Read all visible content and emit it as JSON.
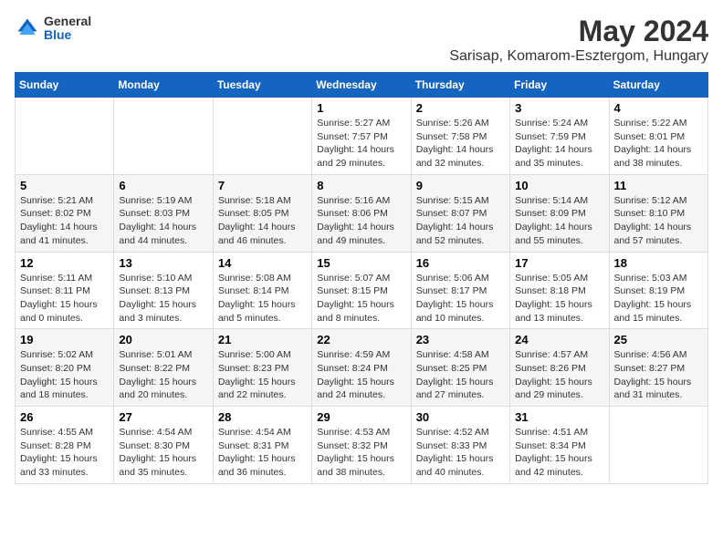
{
  "logo": {
    "line1": "General",
    "line2": "Blue"
  },
  "title": "May 2024",
  "subtitle": "Sarisap, Komarom-Esztergom, Hungary",
  "days_of_week": [
    "Sunday",
    "Monday",
    "Tuesday",
    "Wednesday",
    "Thursday",
    "Friday",
    "Saturday"
  ],
  "weeks": [
    [
      {
        "day": "",
        "content": ""
      },
      {
        "day": "",
        "content": ""
      },
      {
        "day": "",
        "content": ""
      },
      {
        "day": "1",
        "content": "Sunrise: 5:27 AM\nSunset: 7:57 PM\nDaylight: 14 hours\nand 29 minutes."
      },
      {
        "day": "2",
        "content": "Sunrise: 5:26 AM\nSunset: 7:58 PM\nDaylight: 14 hours\nand 32 minutes."
      },
      {
        "day": "3",
        "content": "Sunrise: 5:24 AM\nSunset: 7:59 PM\nDaylight: 14 hours\nand 35 minutes."
      },
      {
        "day": "4",
        "content": "Sunrise: 5:22 AM\nSunset: 8:01 PM\nDaylight: 14 hours\nand 38 minutes."
      }
    ],
    [
      {
        "day": "5",
        "content": "Sunrise: 5:21 AM\nSunset: 8:02 PM\nDaylight: 14 hours\nand 41 minutes."
      },
      {
        "day": "6",
        "content": "Sunrise: 5:19 AM\nSunset: 8:03 PM\nDaylight: 14 hours\nand 44 minutes."
      },
      {
        "day": "7",
        "content": "Sunrise: 5:18 AM\nSunset: 8:05 PM\nDaylight: 14 hours\nand 46 minutes."
      },
      {
        "day": "8",
        "content": "Sunrise: 5:16 AM\nSunset: 8:06 PM\nDaylight: 14 hours\nand 49 minutes."
      },
      {
        "day": "9",
        "content": "Sunrise: 5:15 AM\nSunset: 8:07 PM\nDaylight: 14 hours\nand 52 minutes."
      },
      {
        "day": "10",
        "content": "Sunrise: 5:14 AM\nSunset: 8:09 PM\nDaylight: 14 hours\nand 55 minutes."
      },
      {
        "day": "11",
        "content": "Sunrise: 5:12 AM\nSunset: 8:10 PM\nDaylight: 14 hours\nand 57 minutes."
      }
    ],
    [
      {
        "day": "12",
        "content": "Sunrise: 5:11 AM\nSunset: 8:11 PM\nDaylight: 15 hours\nand 0 minutes."
      },
      {
        "day": "13",
        "content": "Sunrise: 5:10 AM\nSunset: 8:13 PM\nDaylight: 15 hours\nand 3 minutes."
      },
      {
        "day": "14",
        "content": "Sunrise: 5:08 AM\nSunset: 8:14 PM\nDaylight: 15 hours\nand 5 minutes."
      },
      {
        "day": "15",
        "content": "Sunrise: 5:07 AM\nSunset: 8:15 PM\nDaylight: 15 hours\nand 8 minutes."
      },
      {
        "day": "16",
        "content": "Sunrise: 5:06 AM\nSunset: 8:17 PM\nDaylight: 15 hours\nand 10 minutes."
      },
      {
        "day": "17",
        "content": "Sunrise: 5:05 AM\nSunset: 8:18 PM\nDaylight: 15 hours\nand 13 minutes."
      },
      {
        "day": "18",
        "content": "Sunrise: 5:03 AM\nSunset: 8:19 PM\nDaylight: 15 hours\nand 15 minutes."
      }
    ],
    [
      {
        "day": "19",
        "content": "Sunrise: 5:02 AM\nSunset: 8:20 PM\nDaylight: 15 hours\nand 18 minutes."
      },
      {
        "day": "20",
        "content": "Sunrise: 5:01 AM\nSunset: 8:22 PM\nDaylight: 15 hours\nand 20 minutes."
      },
      {
        "day": "21",
        "content": "Sunrise: 5:00 AM\nSunset: 8:23 PM\nDaylight: 15 hours\nand 22 minutes."
      },
      {
        "day": "22",
        "content": "Sunrise: 4:59 AM\nSunset: 8:24 PM\nDaylight: 15 hours\nand 24 minutes."
      },
      {
        "day": "23",
        "content": "Sunrise: 4:58 AM\nSunset: 8:25 PM\nDaylight: 15 hours\nand 27 minutes."
      },
      {
        "day": "24",
        "content": "Sunrise: 4:57 AM\nSunset: 8:26 PM\nDaylight: 15 hours\nand 29 minutes."
      },
      {
        "day": "25",
        "content": "Sunrise: 4:56 AM\nSunset: 8:27 PM\nDaylight: 15 hours\nand 31 minutes."
      }
    ],
    [
      {
        "day": "26",
        "content": "Sunrise: 4:55 AM\nSunset: 8:28 PM\nDaylight: 15 hours\nand 33 minutes."
      },
      {
        "day": "27",
        "content": "Sunrise: 4:54 AM\nSunset: 8:30 PM\nDaylight: 15 hours\nand 35 minutes."
      },
      {
        "day": "28",
        "content": "Sunrise: 4:54 AM\nSunset: 8:31 PM\nDaylight: 15 hours\nand 36 minutes."
      },
      {
        "day": "29",
        "content": "Sunrise: 4:53 AM\nSunset: 8:32 PM\nDaylight: 15 hours\nand 38 minutes."
      },
      {
        "day": "30",
        "content": "Sunrise: 4:52 AM\nSunset: 8:33 PM\nDaylight: 15 hours\nand 40 minutes."
      },
      {
        "day": "31",
        "content": "Sunrise: 4:51 AM\nSunset: 8:34 PM\nDaylight: 15 hours\nand 42 minutes."
      },
      {
        "day": "",
        "content": ""
      }
    ]
  ]
}
